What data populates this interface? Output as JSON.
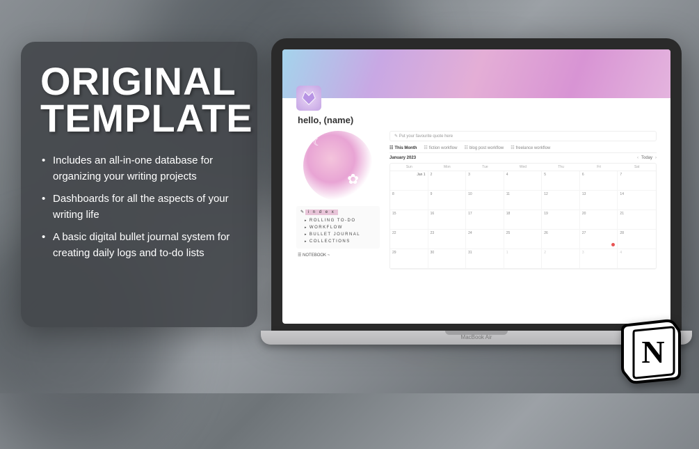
{
  "promo": {
    "title_line1": "ORIGINAL",
    "title_line2": "TEMPLATE",
    "bullets": [
      "Includes an all-in-one database for organizing your writing projects",
      "Dashboards for all the aspects of your writing life",
      "A basic digital bullet journal system for creating daily logs and to-do lists"
    ]
  },
  "laptop": {
    "label": "MacBook Air"
  },
  "page": {
    "greeting": "hello, (name)",
    "quote_placeholder": "Put your favourite quote here",
    "index": {
      "title": "i n d e x",
      "items": [
        "ROLLING TO-DO",
        "WORKFLOW",
        "BULLET JOURNAL",
        "COLLECTIONS"
      ]
    },
    "notebook": "☰ NOTEBOOK ~",
    "tabs": [
      {
        "label": "This Month",
        "icon": "☷"
      },
      {
        "label": "fiction workflow",
        "icon": "☷"
      },
      {
        "label": "blog post workflow",
        "icon": "☷"
      },
      {
        "label": "freelance workflow",
        "icon": "☷"
      }
    ],
    "calendar": {
      "month": "January 2023",
      "today_label": "Today",
      "day_names": [
        "Sun",
        "Mon",
        "Tue",
        "Wed",
        "Thu",
        "Fri",
        "Sat"
      ],
      "weeks": [
        [
          1,
          2,
          3,
          4,
          5,
          6,
          7
        ],
        [
          8,
          9,
          10,
          11,
          12,
          13,
          14
        ],
        [
          15,
          16,
          17,
          18,
          19,
          20,
          21
        ],
        [
          22,
          23,
          24,
          25,
          26,
          27,
          28
        ],
        [
          29,
          30,
          31,
          1,
          2,
          3,
          4
        ]
      ],
      "first_cell_label": "Jan 1",
      "highlight_day": 27
    }
  },
  "logo": {
    "letter": "N"
  }
}
